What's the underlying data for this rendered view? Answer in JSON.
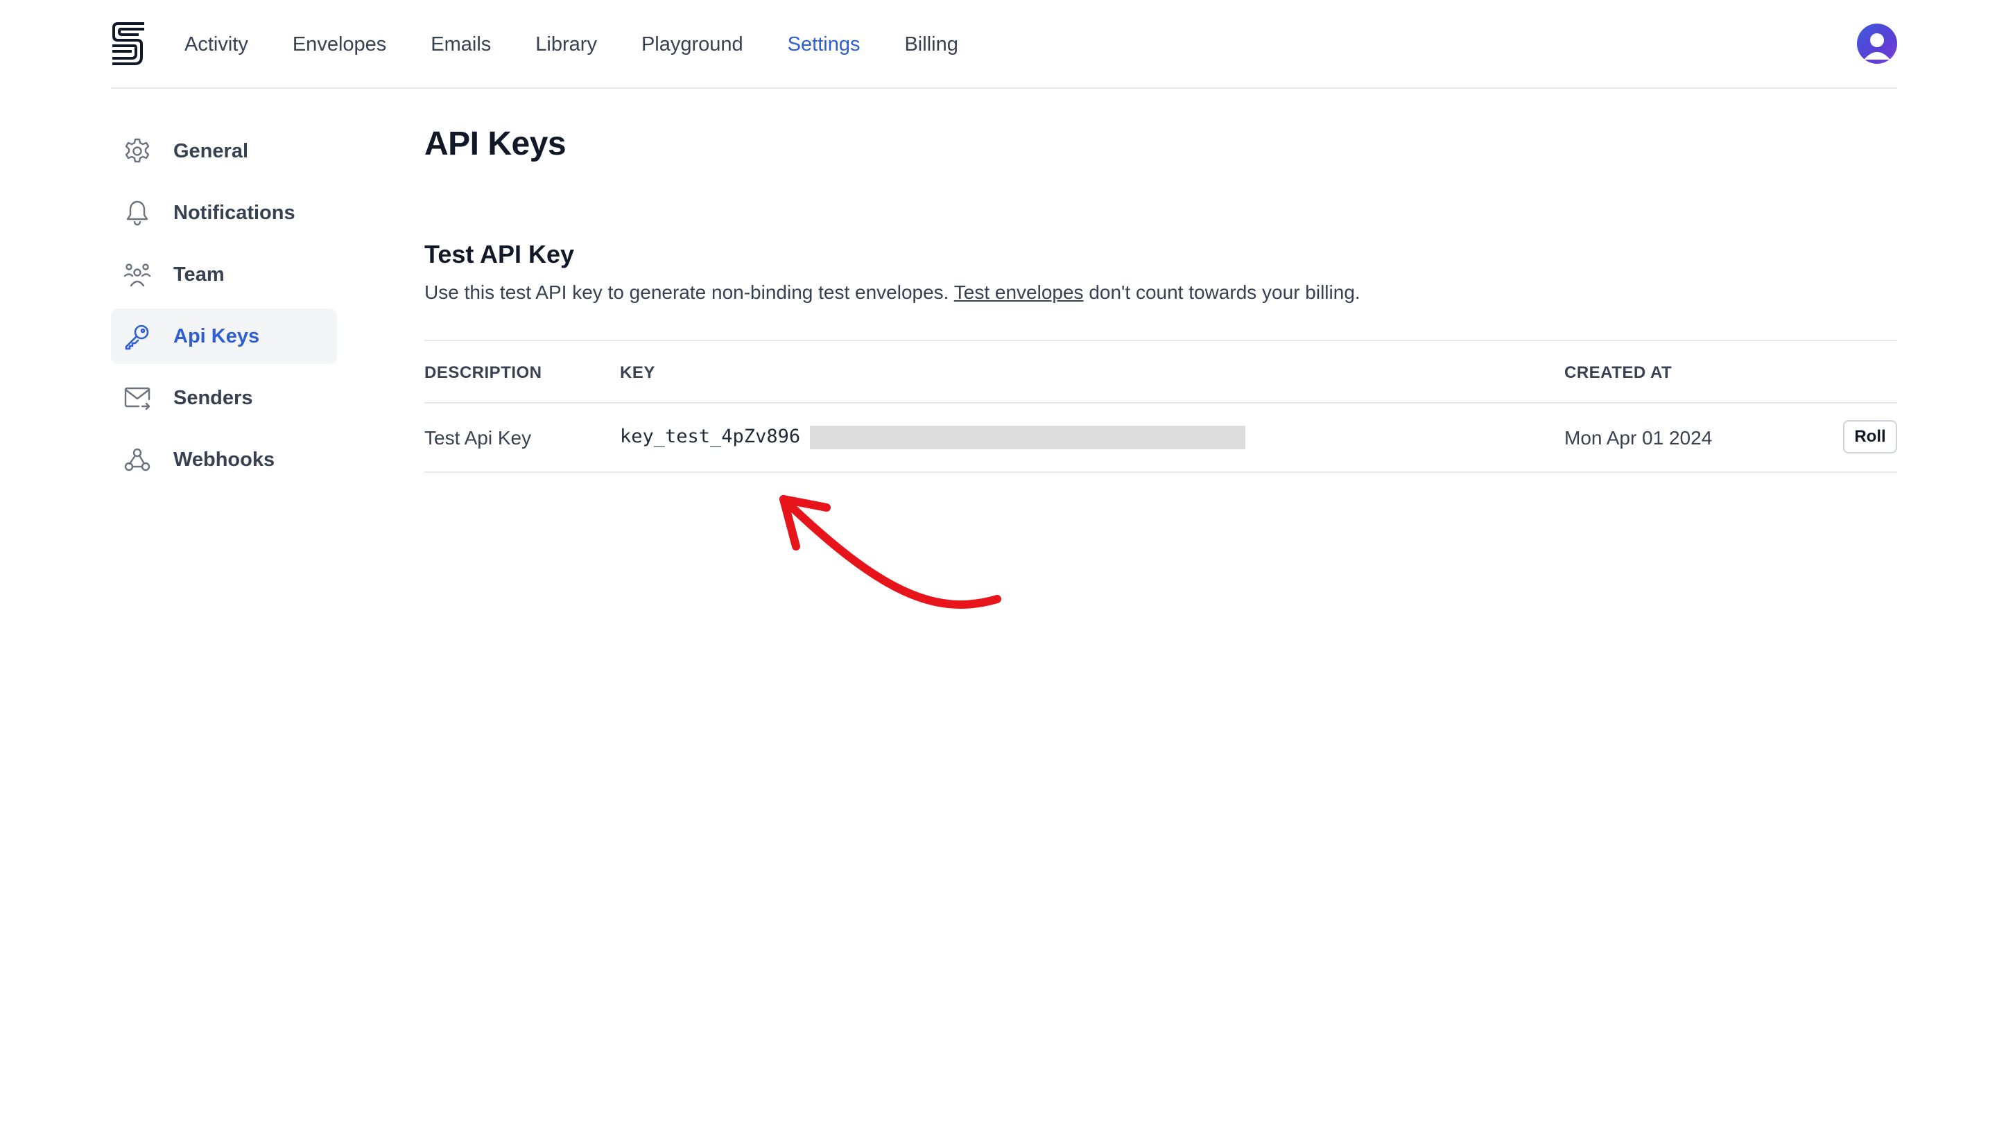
{
  "nav": {
    "items": [
      {
        "label": "Activity",
        "active": false
      },
      {
        "label": "Envelopes",
        "active": false
      },
      {
        "label": "Emails",
        "active": false
      },
      {
        "label": "Library",
        "active": false
      },
      {
        "label": "Playground",
        "active": false
      },
      {
        "label": "Settings",
        "active": true
      },
      {
        "label": "Billing",
        "active": false
      }
    ],
    "logo_icon": "s-logo-icon",
    "avatar_icon": "user-avatar-icon"
  },
  "sidebar": {
    "items": [
      {
        "label": "General",
        "icon": "gear-icon",
        "active": false
      },
      {
        "label": "Notifications",
        "icon": "bell-icon",
        "active": false
      },
      {
        "label": "Team",
        "icon": "team-icon",
        "active": false
      },
      {
        "label": "Api Keys",
        "icon": "key-icon",
        "active": true
      },
      {
        "label": "Senders",
        "icon": "envelope-icon",
        "active": false
      },
      {
        "label": "Webhooks",
        "icon": "webhook-icon",
        "active": false
      }
    ]
  },
  "page": {
    "title": "API Keys",
    "section_title": "Test API Key",
    "desc_before": "Use this test API key to generate non-binding test envelopes. ",
    "desc_link": "Test envelopes",
    "desc_after": " don't count towards your billing."
  },
  "table": {
    "headers": {
      "description": "DESCRIPTION",
      "key": "KEY",
      "created_at": "CREATED AT"
    },
    "rows": [
      {
        "description": "Test Api Key",
        "key": "key_test_4pZv896",
        "created_at": "Mon Apr 01 2024",
        "action": "Roll"
      }
    ]
  },
  "colors": {
    "accent": "#2f5ed4",
    "annotation": "#e8141b"
  }
}
